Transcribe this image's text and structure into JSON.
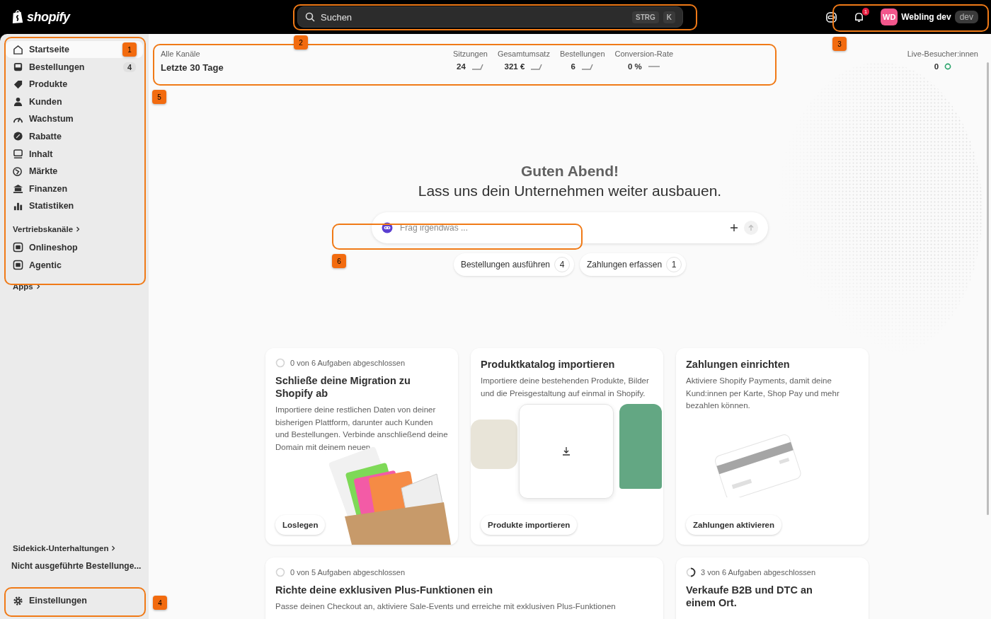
{
  "topbar": {
    "logo": "shopify",
    "search": {
      "placeholder": "Suchen",
      "shortcut": [
        "STRG",
        "K"
      ]
    },
    "notification_count": "1",
    "account": {
      "initials": "WD",
      "name": "Webling dev",
      "tag": "dev"
    }
  },
  "sidebar": {
    "items": [
      {
        "label": "Startseite",
        "selected": true
      },
      {
        "label": "Bestellungen",
        "selected": false,
        "badge": "4"
      },
      {
        "label": "Produkte",
        "selected": false
      },
      {
        "label": "Kunden",
        "selected": false
      },
      {
        "label": "Wachstum",
        "selected": false
      },
      {
        "label": "Rabatte",
        "selected": false
      },
      {
        "label": "Inhalt",
        "selected": false
      },
      {
        "label": "Märkte",
        "selected": false
      },
      {
        "label": "Finanzen",
        "selected": false
      },
      {
        "label": "Statistiken",
        "selected": false
      }
    ],
    "sales_channels": {
      "label": "Vertriebskanäle",
      "items": [
        {
          "label": "Onlineshop",
          "selected": false
        },
        {
          "label": "Agentic",
          "selected": false
        }
      ]
    },
    "apps": {
      "label": "Apps"
    },
    "sidekick": {
      "label": "Sidekick-Unterhaltungen",
      "conversations": [
        "Nicht ausgeführte Bestellunge..."
      ]
    },
    "settings": {
      "label": "Einstellungen",
      "selected": false
    }
  },
  "stats": {
    "channel": "Alle Kanäle",
    "period": "Letzte 30 Tage",
    "metrics": [
      {
        "label": "Sitzungen",
        "value": "24"
      },
      {
        "label": "Gesamtumsatz",
        "value": "321 €"
      },
      {
        "label": "Bestellungen",
        "value": "6"
      },
      {
        "label": "Conversion-Rate",
        "value": "0 %"
      }
    ],
    "live": {
      "label": "Live-Besucher:innen",
      "value": "0"
    }
  },
  "hero": {
    "greeting": "Guten Abend!",
    "headline": "Lass uns dein Unternehmen weiter ausbauen.",
    "ask": {
      "placeholder": "Frag irgendwas ..."
    },
    "chips": [
      {
        "label": "Bestellungen ausführen",
        "count": "4"
      },
      {
        "label": "Zahlungen erfassen",
        "count": "1"
      }
    ]
  },
  "cards": [
    {
      "kind": "box",
      "progress": {
        "text": "0 von 6 Aufgaben abgeschlossen",
        "kind": "empty"
      },
      "title": "Schließe deine Migration zu Shopify ab",
      "text": "Importiere deine restlichen Daten von deiner bisherigen Plattform, darunter auch Kunden und Bestellungen. Verbinde anschließend deine Domain mit deinem neuen",
      "button": "Loslegen"
    },
    {
      "kind": "products",
      "title": "Produktkatalog importieren",
      "text": "Importiere deine bestehenden Produkte, Bilder und die Preisgestaltung auf einmal in Shopify.",
      "button": "Produkte importieren"
    },
    {
      "kind": "card",
      "title": "Zahlungen einrichten",
      "text": "Aktiviere Shopify Payments, damit deine Kund:innen per Karte, Shop Pay und mehr bezahlen können.",
      "button": "Zahlungen aktivieren"
    },
    {
      "kind": "wide",
      "progress": {
        "text": "0 von 5 Aufgaben abgeschlossen",
        "kind": "empty"
      },
      "title": "Richte deine exklusiven Plus-Funktionen ein",
      "text": "Passe deinen Checkout an, aktiviere Sale-Events und erreiche mit exklusiven Plus-Funktionen"
    },
    {
      "kind": "plain",
      "progress": {
        "text": "3 von 6 Aufgaben abgeschlossen",
        "kind": "partial"
      },
      "title": "Verkaufe B2B und DTC an einem Ort."
    }
  ],
  "annotations": [
    {
      "label": "1"
    },
    {
      "label": "2"
    },
    {
      "label": "3"
    },
    {
      "label": "4"
    },
    {
      "label": "5"
    },
    {
      "label": "6"
    }
  ]
}
